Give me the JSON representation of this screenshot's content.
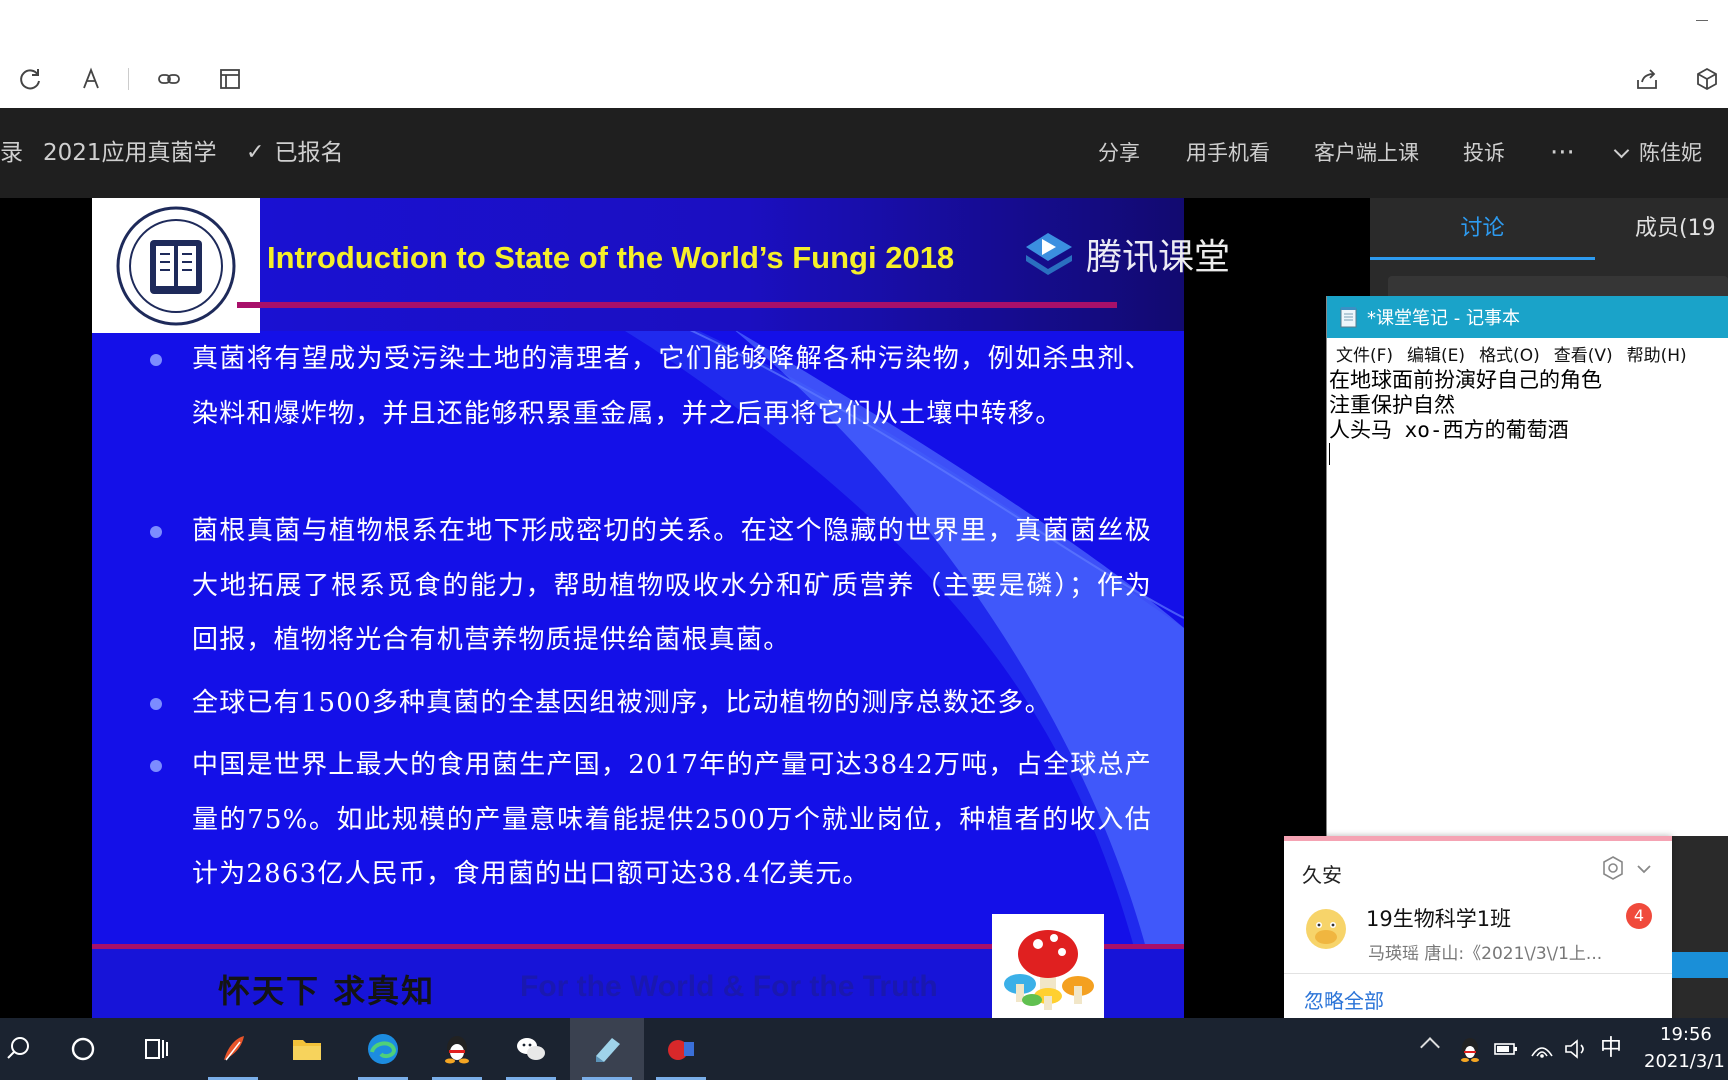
{
  "browser": {
    "toolbar_icons": [
      "refresh-icon",
      "font-icon",
      "link-icon",
      "reader-icon",
      "share-icon",
      "3d-box-icon"
    ]
  },
  "course_header": {
    "back_text": "录",
    "course_title": "2021应用真菌学",
    "enroll_check": "✓",
    "enroll_status": "已报名",
    "actions": {
      "share": "分享",
      "phone": "用手机看",
      "client": "客户端上课",
      "report": "投诉",
      "more": "···"
    },
    "user_name": "陈佳妮"
  },
  "slide": {
    "title": "Introduction to State of the World’s Fungi 2018",
    "watermark": "腾讯课堂",
    "bullets": [
      "真菌将有望成为受污染土地的清理者，它们能够降解各种污染物，例如杀虫剂、染料和爆炸物，并且还能够积累重金属，并之后再将它们从土壤中转移。",
      "菌根真菌与植物根系在地下形成密切的关系。在这个隐藏的世界里，真菌菌丝极大地拓展了根系觅食的能力，帮助植物吸收水分和矿质营养（主要是磷）；作为回报，植物将光合有机营养物质提供给菌根真菌。",
      "全球已有1500多种真菌的全基因组被测序，比动植物的测序总数还多。",
      "中国是世界上最大的食用菌生产国，2017年的产量可达3842万吨，占全球总产量的75%。如此规模的产量意味着能提供2500万个就业岗位，种植者的收入估计为2863亿人民币，食用菌的出口额可达38.4亿美元。"
    ],
    "footer_cn": "怀天下 求真知",
    "footer_en": "For the World & For the Truth",
    "colors": {
      "background": "#1410e8",
      "title": "#f5ef2a",
      "accent_rule": "#a8106a"
    }
  },
  "side_panel": {
    "tab_discuss": "讨论",
    "tab_members": "成员(19",
    "accent": "#2d9bf0"
  },
  "notepad": {
    "title": "*课堂笔记 - 记事本",
    "menu": [
      "文件(F)",
      "编辑(E)",
      "格式(O)",
      "查看(V)",
      "帮助(H)"
    ],
    "content": "在地球面前扮演好自己的角色\n注重保护自然\n人头马 xo-西方的葡萄酒"
  },
  "qq_notification": {
    "contact": "久安",
    "group_name": "19生物科学1班",
    "unread": "4",
    "preview": "马瑛瑶    唐山:《2021\\/3\\/1上...",
    "ignore_all": "忽略全部"
  },
  "taskbar": {
    "apps": [
      "search-icon",
      "cortana-icon",
      "task-view-icon",
      "feather-app-icon",
      "file-explorer-icon",
      "edge-icon",
      "qq-icon",
      "wechat-icon",
      "notepad-icon",
      "tencent-classroom-icon"
    ],
    "ime": "中",
    "time": "19:56",
    "date": "2021/3/1"
  }
}
